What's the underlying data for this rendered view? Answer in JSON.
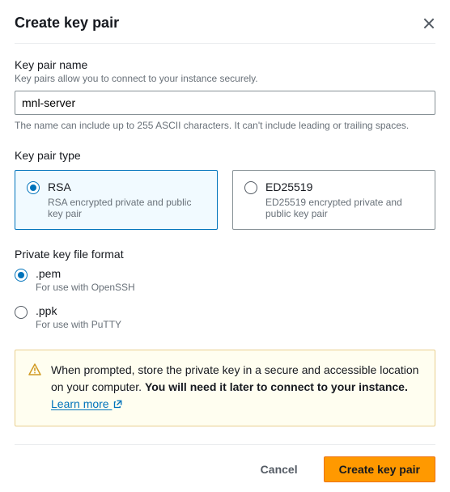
{
  "header": {
    "title": "Create key pair"
  },
  "name_field": {
    "label": "Key pair name",
    "help": "Key pairs allow you to connect to your instance securely.",
    "value": "mnl-server",
    "hint": "The name can include up to 255 ASCII characters. It can't include leading or trailing spaces."
  },
  "type_field": {
    "label": "Key pair type",
    "options": [
      {
        "id": "rsa",
        "title": "RSA",
        "desc": "RSA encrypted private and public key pair",
        "selected": true
      },
      {
        "id": "ed25519",
        "title": "ED25519",
        "desc": "ED25519 encrypted private and public key pair",
        "selected": false
      }
    ]
  },
  "format_field": {
    "label": "Private key file format",
    "options": [
      {
        "id": "pem",
        "title": ".pem",
        "desc": "For use with OpenSSH",
        "selected": true
      },
      {
        "id": "ppk",
        "title": ".ppk",
        "desc": "For use with PuTTY",
        "selected": false
      }
    ]
  },
  "alert": {
    "text_before": "When prompted, store the private key in a secure and accessible location on your computer. ",
    "text_bold": "You will need it later to connect to your instance.",
    "link_label": "Learn more"
  },
  "footer": {
    "cancel": "Cancel",
    "submit": "Create key pair"
  }
}
